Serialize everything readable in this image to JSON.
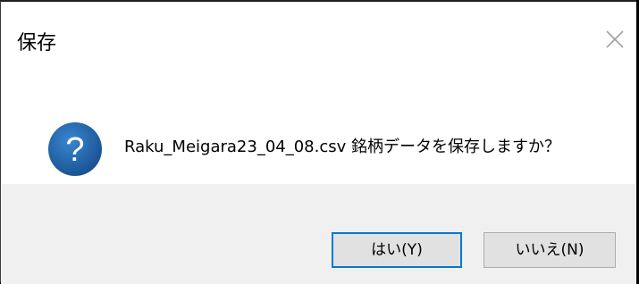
{
  "dialog": {
    "title": "保存",
    "close_icon": "close-icon",
    "message": "Raku_Meigara23_04_08.csv 銘柄データを保存しますか？",
    "icon": "question-icon",
    "accent_color": "#0078d7",
    "icon_color": "#1e5aa0"
  },
  "buttons": {
    "yes_label": "はい(Y)",
    "no_label": "いいえ(N)"
  }
}
